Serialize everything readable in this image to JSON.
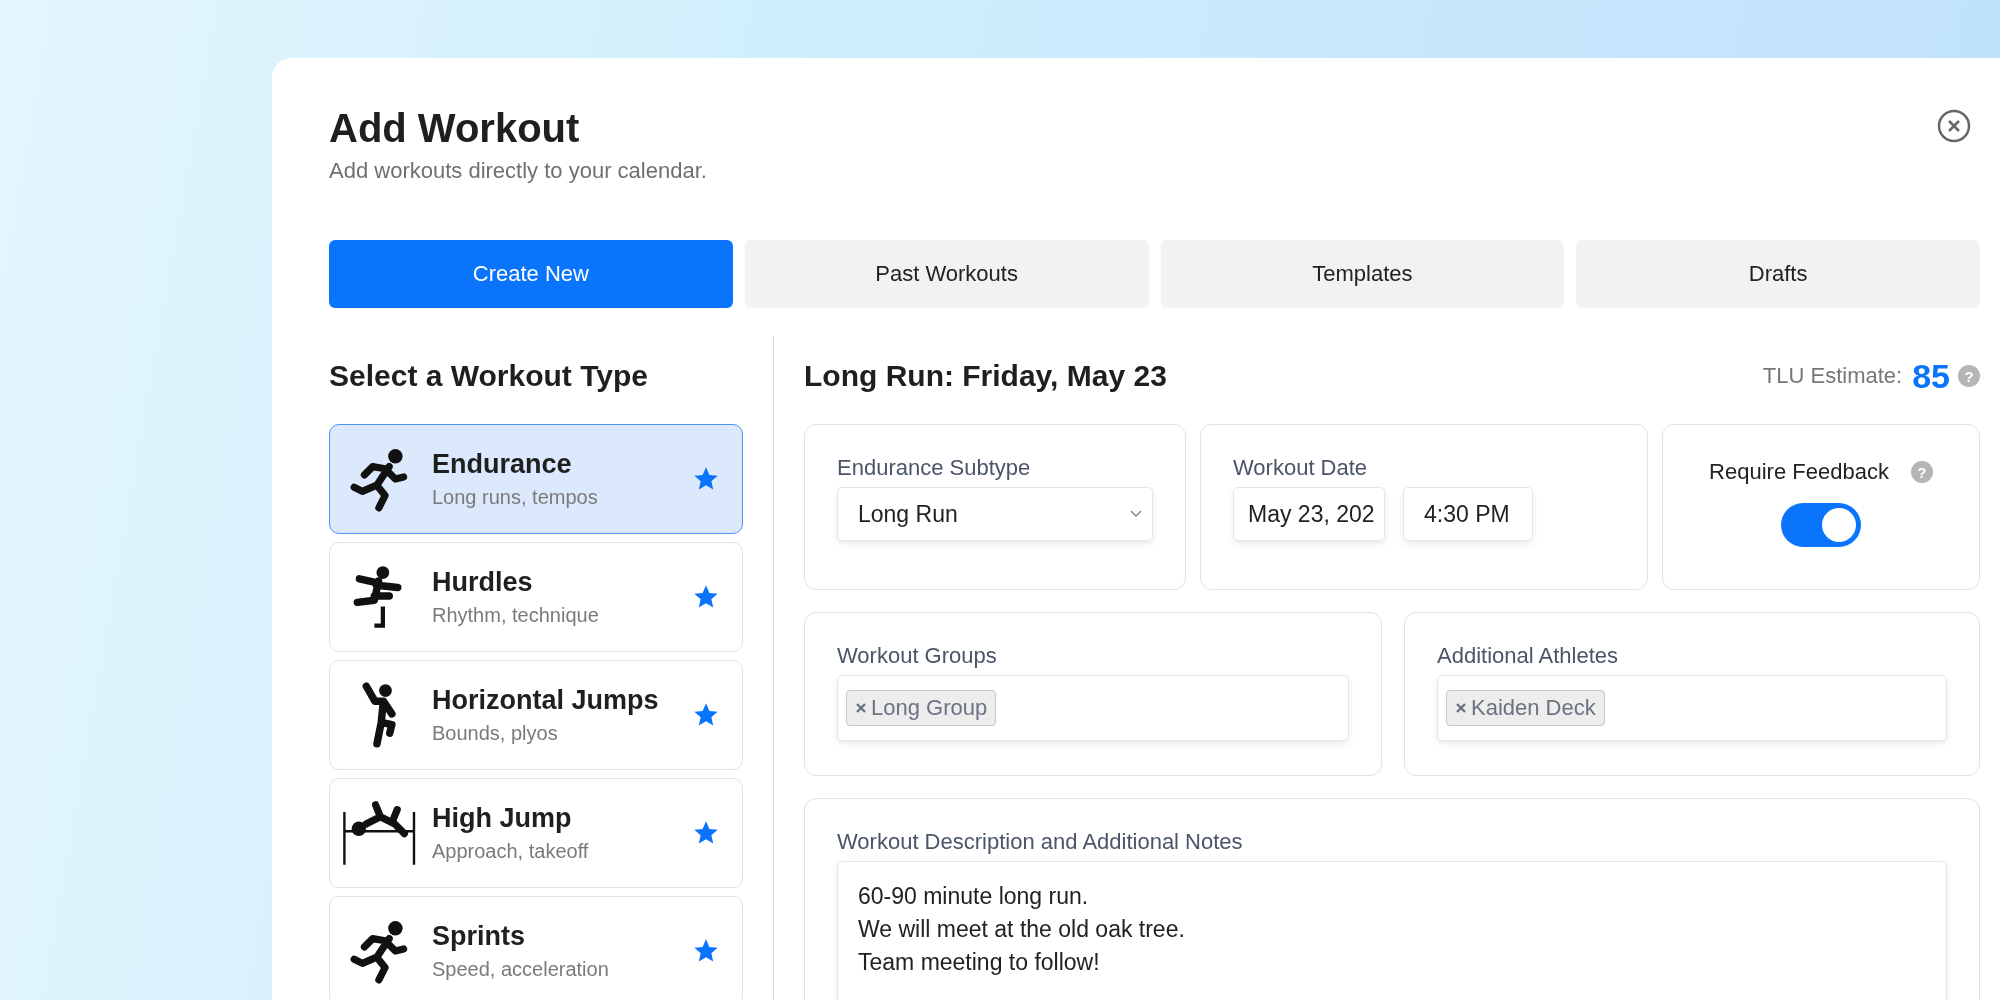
{
  "dialog": {
    "title": "Add Workout",
    "subtitle": "Add workouts directly to your calendar."
  },
  "tabs": [
    {
      "label": "Create New",
      "selected": true
    },
    {
      "label": "Past Workouts",
      "selected": false
    },
    {
      "label": "Templates",
      "selected": false
    },
    {
      "label": "Drafts",
      "selected": false
    }
  ],
  "workout_types": {
    "heading": "Select a Workout Type",
    "items": [
      {
        "kind": "runner",
        "name": "Endurance",
        "description": "Long runs, tempos",
        "selected": true,
        "favorite": true
      },
      {
        "kind": "hurdler",
        "name": "Hurdles",
        "description": "Rhythm, technique",
        "selected": false,
        "favorite": true
      },
      {
        "kind": "jumper",
        "name": "Horizontal Jumps",
        "description": "Bounds, plyos",
        "selected": false,
        "favorite": true
      },
      {
        "kind": "high_jump",
        "name": "High Jump",
        "description": "Approach, takeoff",
        "selected": false,
        "favorite": true
      },
      {
        "kind": "runner",
        "name": "Sprints",
        "description": "Speed, acceleration",
        "selected": false,
        "favorite": true
      }
    ]
  },
  "detail": {
    "heading": "Long Run: Friday, May 23",
    "tlu_label": "TLU Estimate:",
    "tlu_value": "85",
    "tlu_help": "?",
    "subtype": {
      "label": "Endurance Subtype",
      "value": "Long Run"
    },
    "date": {
      "label": "Workout Date",
      "date": "May 23, 202",
      "time": "4:30 PM"
    },
    "feedback": {
      "label": "Require Feedback",
      "help": "?",
      "on": true
    },
    "groups": {
      "label": "Workout Groups",
      "tags": [
        "Long Group"
      ]
    },
    "athletes": {
      "label": "Additional Athletes",
      "tags": [
        "Kaiden Deck"
      ]
    },
    "notes": {
      "label": "Workout Description and Additional Notes",
      "value": "60-90 minute long run.\nWe will meet at the old oak tree.\nTeam meeting to follow!"
    }
  }
}
